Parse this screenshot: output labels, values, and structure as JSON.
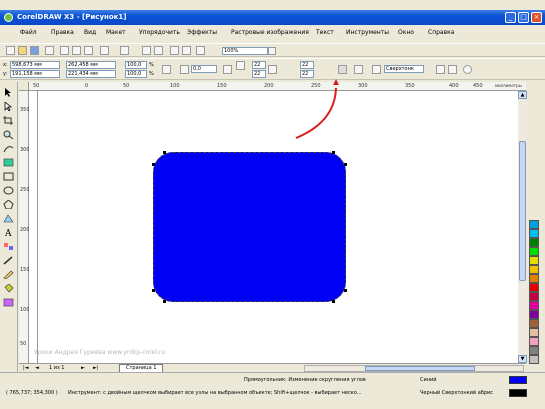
{
  "window": {
    "title": "CorelDRAW X3 - [Рисунок1]",
    "controls": [
      "_",
      "□",
      "×"
    ]
  },
  "menu": [
    "Файл",
    "Правка",
    "Вид",
    "Макет",
    "Упорядочить",
    "Эффекты",
    "Растровые изображения",
    "Текст",
    "Инструменты",
    "Окно",
    "Справка"
  ],
  "toolbar_standard": {
    "zoom_value": "100%"
  },
  "property_bar": {
    "x_value": "598,673 мм",
    "y_value": "191,158 мм",
    "width_value": "262,458 мм",
    "height_value": "221,434 мм",
    "scale_x": "100,0",
    "scale_y": "100,0",
    "scale_unit": "%",
    "angle_value": "0,0",
    "corner_tl": "22",
    "corner_tr": "22",
    "corner_bl": "22",
    "corner_br": "22",
    "outline_width": "Сверхтонк"
  },
  "ruler_h_ticks": [
    "50",
    "0",
    "50",
    "100",
    "150",
    "200",
    "250",
    "300",
    "350",
    "400",
    "450",
    "500",
    "миллиметры"
  ],
  "ruler_v_ticks": [
    "350",
    "300",
    "250",
    "200",
    "150",
    "100",
    "50"
  ],
  "canvas": {
    "shape_fill": "#0000F4",
    "watermark": "Уроки Андрея Гуреева www.yrokp-corel.ru"
  },
  "page_nav": {
    "counter": "1 из 1",
    "tab_label": "Страница 1"
  },
  "palette_colors": [
    "#00A0E0",
    "#00C0F0",
    "#008000",
    "#00E000",
    "#E0E000",
    "#F0C000",
    "#E08000",
    "#E00000",
    "#C00040",
    "#E000A0",
    "#8000A0",
    "#A06040",
    "#E0C0A0",
    "#F0A0C0",
    "#808080",
    "#C0C0C0"
  ],
  "status": {
    "hint": "Прямоугольник: Изменение скругления углов",
    "coords": "( 765,737; 354,300 )",
    "tool_help": "Инструмент: с двойным щелчком выбирает все узлы на выбранном объекте; Shift+щелчок - выбирает неско...",
    "fill_label": "Синий",
    "outline_label": "Черный  Сверхтонкий абрис",
    "fill_color": "#0000F4",
    "outline_color": "#000000"
  }
}
